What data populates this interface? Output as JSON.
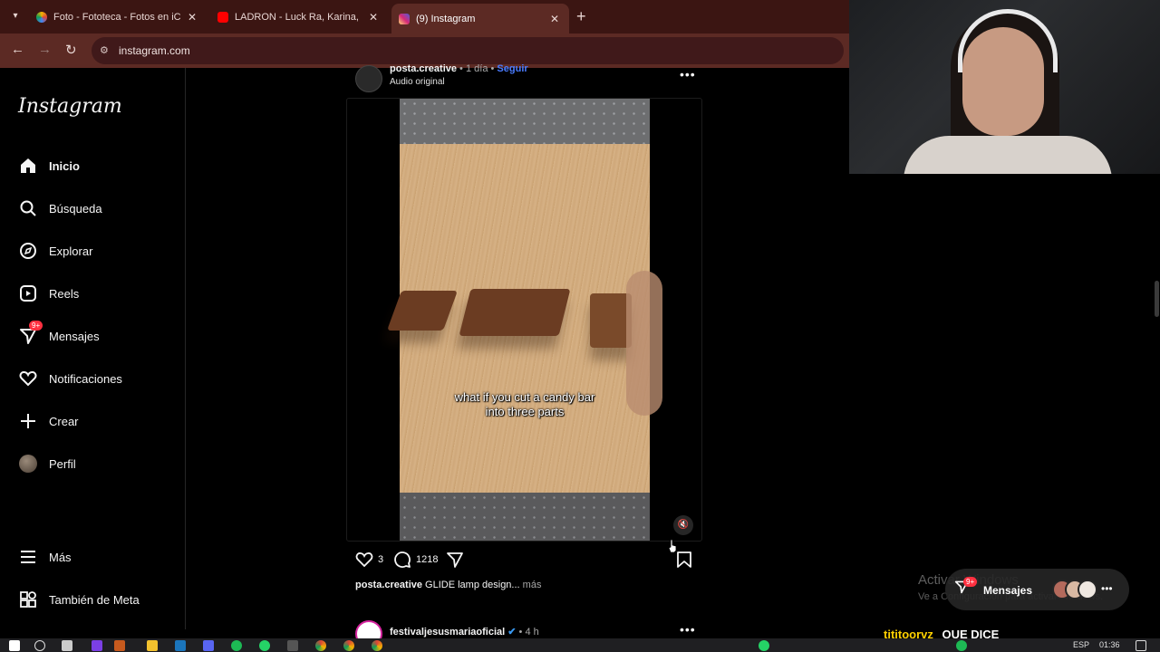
{
  "browser": {
    "tabs": [
      {
        "title": "Foto - Fototeca - Fotos en iCloud",
        "favicon": "photos-icon",
        "active": false
      },
      {
        "title": "LADRON - Luck Ra, Karina, Zaira",
        "favicon": "youtube-icon",
        "active": false
      },
      {
        "title": "(9) Instagram",
        "favicon": "instagram-icon",
        "active": true
      }
    ],
    "url": "instagram.com"
  },
  "instagram": {
    "logo": "Instagram",
    "nav": [
      {
        "label": "Inicio",
        "icon": "home-icon",
        "bold": true
      },
      {
        "label": "Búsqueda",
        "icon": "search-icon"
      },
      {
        "label": "Explorar",
        "icon": "compass-icon"
      },
      {
        "label": "Reels",
        "icon": "reels-icon"
      },
      {
        "label": "Mensajes",
        "icon": "messenger-icon",
        "badge": "9+"
      },
      {
        "label": "Notificaciones",
        "icon": "heart-icon"
      },
      {
        "label": "Crear",
        "icon": "plus-icon"
      },
      {
        "label": "Perfil",
        "icon": "avatar"
      }
    ],
    "more": {
      "label": "Más",
      "icon": "menu-icon"
    },
    "meta": {
      "label": "También de Meta",
      "icon": "meta-grid-icon"
    }
  },
  "post": {
    "username": "posta.creative",
    "time": "1 día",
    "follow": "Seguir",
    "audio": "Audio original",
    "video_caption_1": "what if you cut a candy bar",
    "video_caption_2": "into three parts",
    "likes": "3",
    "comments": "1218",
    "caption_user": "posta.creative",
    "caption_text": "GLIDE lamp design...",
    "caption_more": "más"
  },
  "next_post": {
    "username": "festivaljesusmariaoficial",
    "time": "4 h"
  },
  "messages_pill": {
    "label": "Mensajes",
    "badge": "9+"
  },
  "watermark": {
    "line1": "Activar Windows",
    "line2": "Ve a Configuración para activar Windows."
  },
  "stream_chat": {
    "name": "tititoorvz",
    "message": "QUE DICE"
  },
  "taskbar": {
    "language": "ESP",
    "clock": "01:36"
  },
  "colors": {
    "tab_strip": "#3b1512",
    "toolbar": "#5c2a24",
    "follow_blue": "#4a7cff",
    "badge_red": "#ff3040"
  }
}
